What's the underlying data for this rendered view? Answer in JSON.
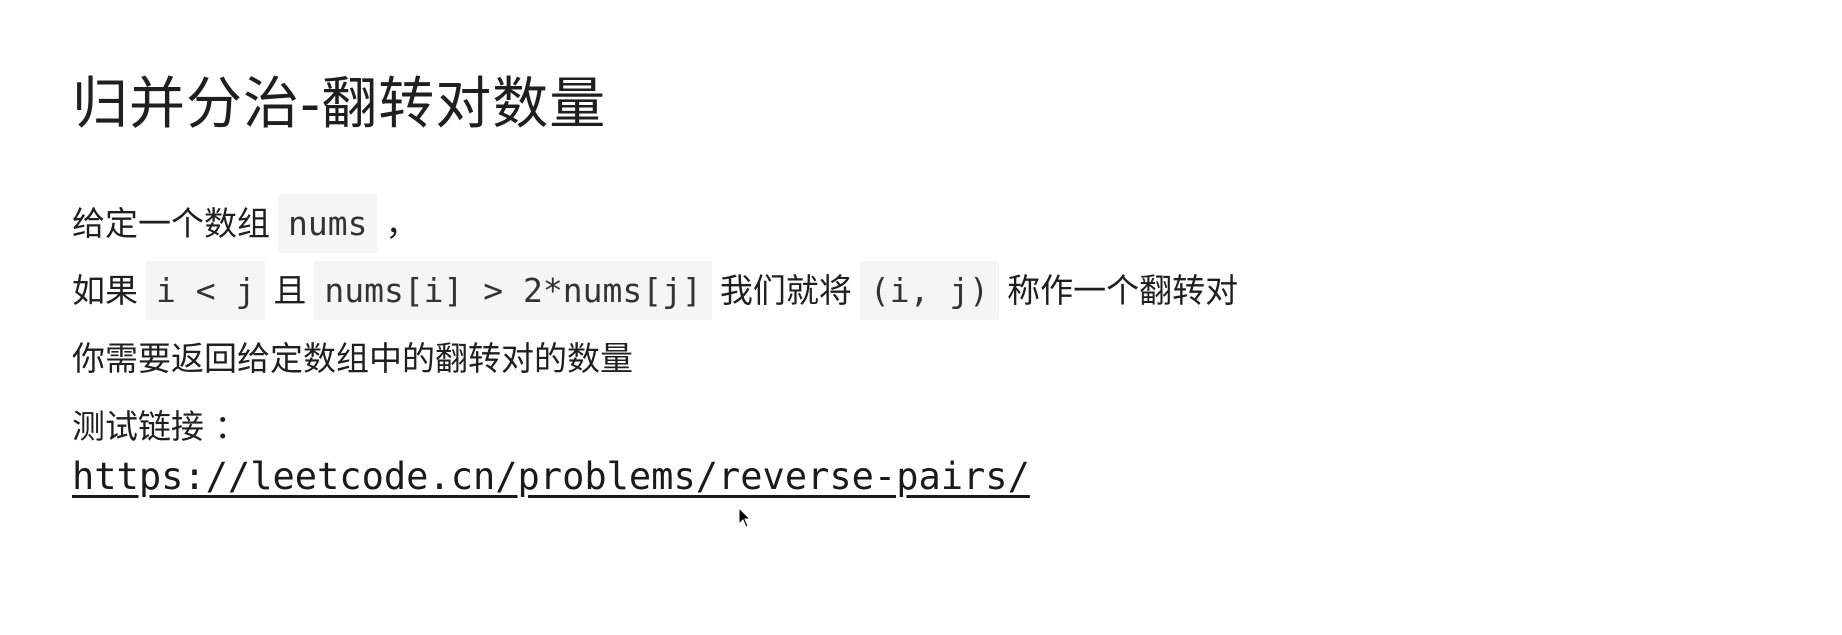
{
  "document": {
    "title": "归并分治-翻转对数量",
    "line1": {
      "text_a": "给定一个数组",
      "code_nums": "nums",
      "text_b": "，"
    },
    "line2": {
      "text_a": "如果",
      "code_cond1": "i < j",
      "text_b": "且",
      "code_cond2": "nums[i] > 2*nums[j]",
      "text_c": "我们就将",
      "code_pair": "(i, j)",
      "text_d": "称作一个翻转对"
    },
    "line3": {
      "text": "你需要返回给定数组中的翻转对的数量"
    },
    "test_link": {
      "label": "测试链接 ：",
      "url": "https://leetcode.cn/problems/reverse-pairs/"
    }
  }
}
